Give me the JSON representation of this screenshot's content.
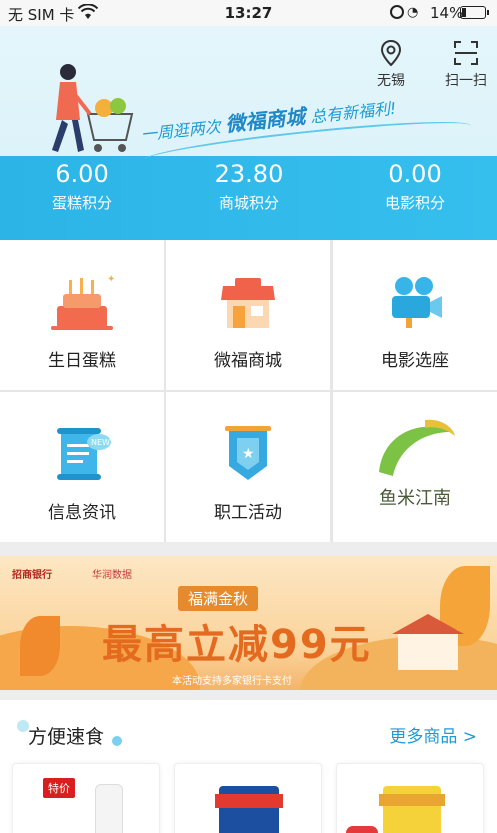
{
  "status_bar": {
    "carrier": "无 SIM 卡",
    "time": "13:27",
    "battery": "14%"
  },
  "header": {
    "location_label": "无锡",
    "scan_label": "扫一扫",
    "slogan_prefix": "一周逛两次",
    "slogan_highlight": "微福商城",
    "slogan_suffix": "总有新福利!",
    "points": [
      {
        "value": "6.00",
        "label": "蛋糕积分"
      },
      {
        "value": "23.80",
        "label": "商城积分"
      },
      {
        "value": "0.00",
        "label": "电影积分"
      }
    ]
  },
  "grid": {
    "items": [
      {
        "label": "生日蛋糕",
        "icon": "cake-icon"
      },
      {
        "label": "微福商城",
        "icon": "shop-icon"
      },
      {
        "label": "电影选座",
        "icon": "movie-camera-icon"
      },
      {
        "label": "信息资讯",
        "icon": "news-scroll-icon"
      },
      {
        "label": "职工活动",
        "icon": "activity-banner-icon"
      },
      {
        "label": "鱼米江南",
        "icon": "yumi-jiangnan-logo"
      }
    ]
  },
  "banner": {
    "bank": "招商银行",
    "partner": "华润数据",
    "tag": "福满金秋",
    "headline": "最高立减99元",
    "note": "本活动支持多家银行卡支付"
  },
  "section": {
    "title": "方便速食",
    "more": "更多商品 >",
    "product_badge": "特价"
  },
  "colors": {
    "accent": "#2bb3e6",
    "link": "#1e9ad6"
  }
}
